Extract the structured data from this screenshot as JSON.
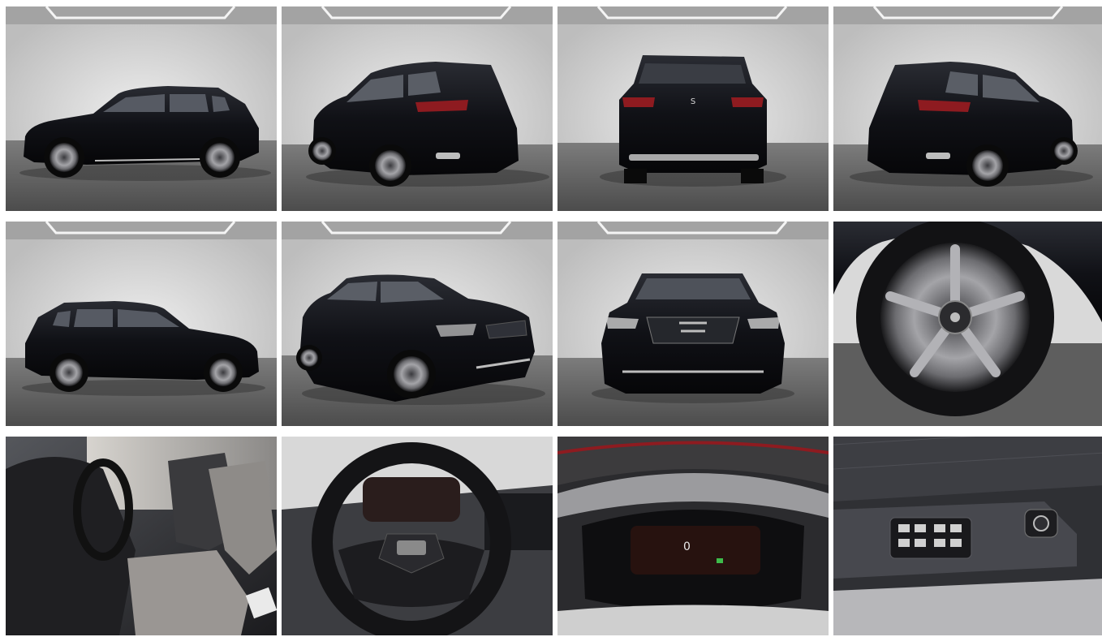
{
  "gallery": {
    "photos": [
      {
        "view": "side-left",
        "badge": ""
      },
      {
        "view": "rear-left-three-quarter",
        "badge": ""
      },
      {
        "view": "rear",
        "badge": "S"
      },
      {
        "view": "rear-right-three-quarter",
        "badge": ""
      },
      {
        "view": "side-right",
        "badge": ""
      },
      {
        "view": "front-left-three-quarter",
        "badge": ""
      },
      {
        "view": "front",
        "badge": ""
      },
      {
        "view": "wheel-closeup",
        "badge": ""
      },
      {
        "view": "interior-front-seats",
        "badge": ""
      },
      {
        "view": "steering-wheel",
        "badge": ""
      },
      {
        "view": "instrument-cluster",
        "badge": "0"
      },
      {
        "view": "door-window-switches",
        "badge": ""
      }
    ]
  },
  "colors": {
    "studio_wall": "#e2e2e2",
    "studio_floor": "#6d6d6d",
    "car_body": "#121318",
    "tail_light": "#8e1b20",
    "wheel_rim": "#8f8f93",
    "interior_dark": "#2b2b2e",
    "seat_fabric": "#9a9693"
  }
}
